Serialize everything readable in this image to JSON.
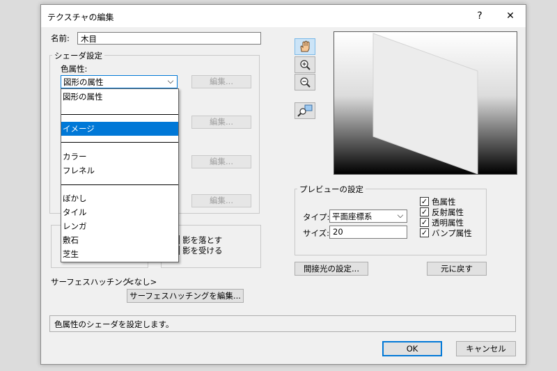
{
  "dialog": {
    "title": "テクスチャの編集",
    "help_label": "?",
    "close_label": "✕"
  },
  "name": {
    "label": "名前:",
    "value": "木目"
  },
  "shader": {
    "group_title": "シェーダ設定",
    "color_attr_label": "色属性:",
    "color_attr_value": "図形の属性",
    "dropdown_arrow": "⌵",
    "edit_label": "編集...",
    "dropdown_items": [
      {
        "label": "図形の属性"
      },
      {
        "label": "イメージ"
      },
      {
        "label": "カラー"
      },
      {
        "label": "フレネル"
      },
      {
        "label": "ぼかし"
      },
      {
        "label": "タイル"
      },
      {
        "label": "レンガ"
      },
      {
        "label": "敷石"
      },
      {
        "label": "芝生"
      }
    ]
  },
  "shadow": {
    "cast_label": "影を落とす",
    "receive_label": "影を受ける"
  },
  "hatching": {
    "label": "サーフェスハッチング:",
    "value": "<なし>",
    "edit_button": "サーフェスハッチングを編集..."
  },
  "preview_settings": {
    "group_title": "プレビューの設定",
    "type_label": "タイプ:",
    "type_value": "平面座標系",
    "size_label": "サイズ:",
    "size_value": "20",
    "checks": [
      {
        "label": "色属性",
        "checked": true
      },
      {
        "label": "反射属性",
        "checked": true
      },
      {
        "label": "透明属性",
        "checked": true
      },
      {
        "label": "バンプ属性",
        "checked": true
      }
    ],
    "indirect_light_button": "間接光の設定...",
    "reset_button": "元に戻す"
  },
  "tools": [
    {
      "icon": "hand-pan-icon"
    },
    {
      "icon": "zoom-in-icon"
    },
    {
      "icon": "zoom-out-icon"
    },
    {
      "icon": "zoom-fit-icon"
    }
  ],
  "status_text": "色属性のシェーダを設定します。",
  "buttons": {
    "ok": "OK",
    "cancel": "キャンセル"
  },
  "colors": {
    "selection": "#0078d7",
    "dialog_bg": "#f0f0f0"
  }
}
